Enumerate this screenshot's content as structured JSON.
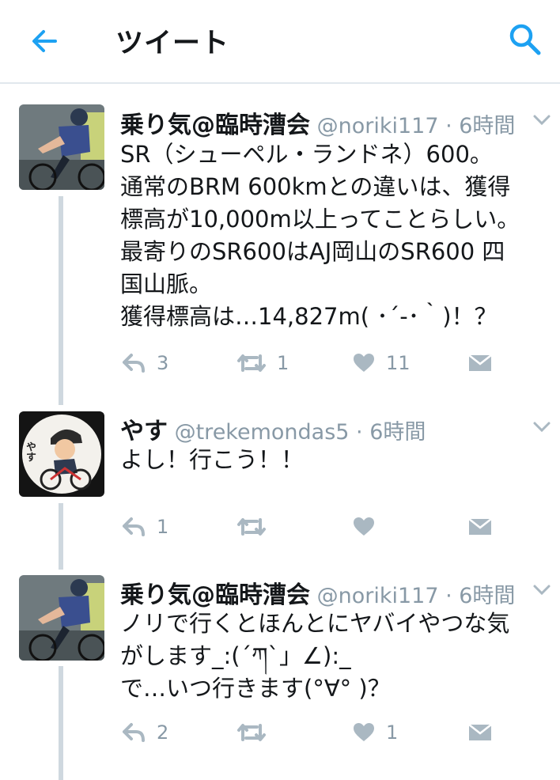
{
  "header": {
    "title": "ツイート",
    "back_icon": "arrow-left-icon",
    "search_icon": "search-icon",
    "accent": "#1da1f2"
  },
  "tweets": [
    {
      "display_name": "乗り気@臨時漕会",
      "handle": "@noriki117",
      "separator": " · ",
      "time": "6時間",
      "text": "SR（シューペル・ランドネ）600。\n通常のBRM 600kmとの違いは、獲得\n標高が10,000m以上ってことらしい。\n最寄りのSR600はAJ岡山のSR600 四\n国山脈。\n獲得標高は…14,827m( ･´-･｀)！？",
      "replies": "3",
      "retweets": "1",
      "likes": "11"
    },
    {
      "display_name": "やす",
      "handle": "@trekemondas5",
      "separator": " · ",
      "time": "6時間",
      "text": "よし！行こう！！",
      "replies": "1",
      "retweets": "",
      "likes": "",
      "avatar_text": "やす"
    },
    {
      "display_name": "乗り気@臨時漕会",
      "handle": "@noriki117",
      "separator": " · ",
      "time": "6時間",
      "text": "ノリで行くとほんとにヤバイやつな気\nがします_:(´ཀ`」∠):_\nで…いつ行きます(°∀° )？",
      "replies": "2",
      "retweets": "",
      "likes": "1"
    }
  ],
  "colors": {
    "text": "#14171a",
    "muted": "#8899a6",
    "icon": "#aab8c2",
    "line": "#cfd8df"
  }
}
